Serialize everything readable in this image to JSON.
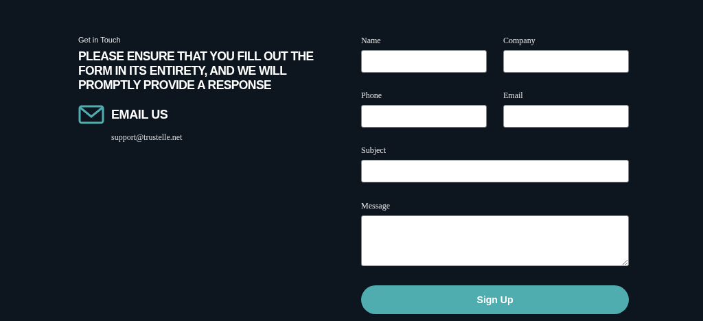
{
  "eyebrow": "Get in Touch",
  "heading": "PLEASE ENSURE THAT YOU FILL OUT THE FORM IN ITS ENTIRETY, AND WE WILL PROMPTLY PROVIDE A RESPONSE",
  "contact": {
    "title": "EMAIL US",
    "address": "support@trustelle.net"
  },
  "form": {
    "fields": [
      {
        "label": "Name",
        "kind": "half"
      },
      {
        "label": "Company",
        "kind": "half"
      },
      {
        "label": "Phone",
        "kind": "half"
      },
      {
        "label": "Email",
        "kind": "half"
      },
      {
        "label": "Subject",
        "kind": "full"
      },
      {
        "label": "Message",
        "kind": "textarea"
      }
    ],
    "submit": "Sign Up"
  }
}
